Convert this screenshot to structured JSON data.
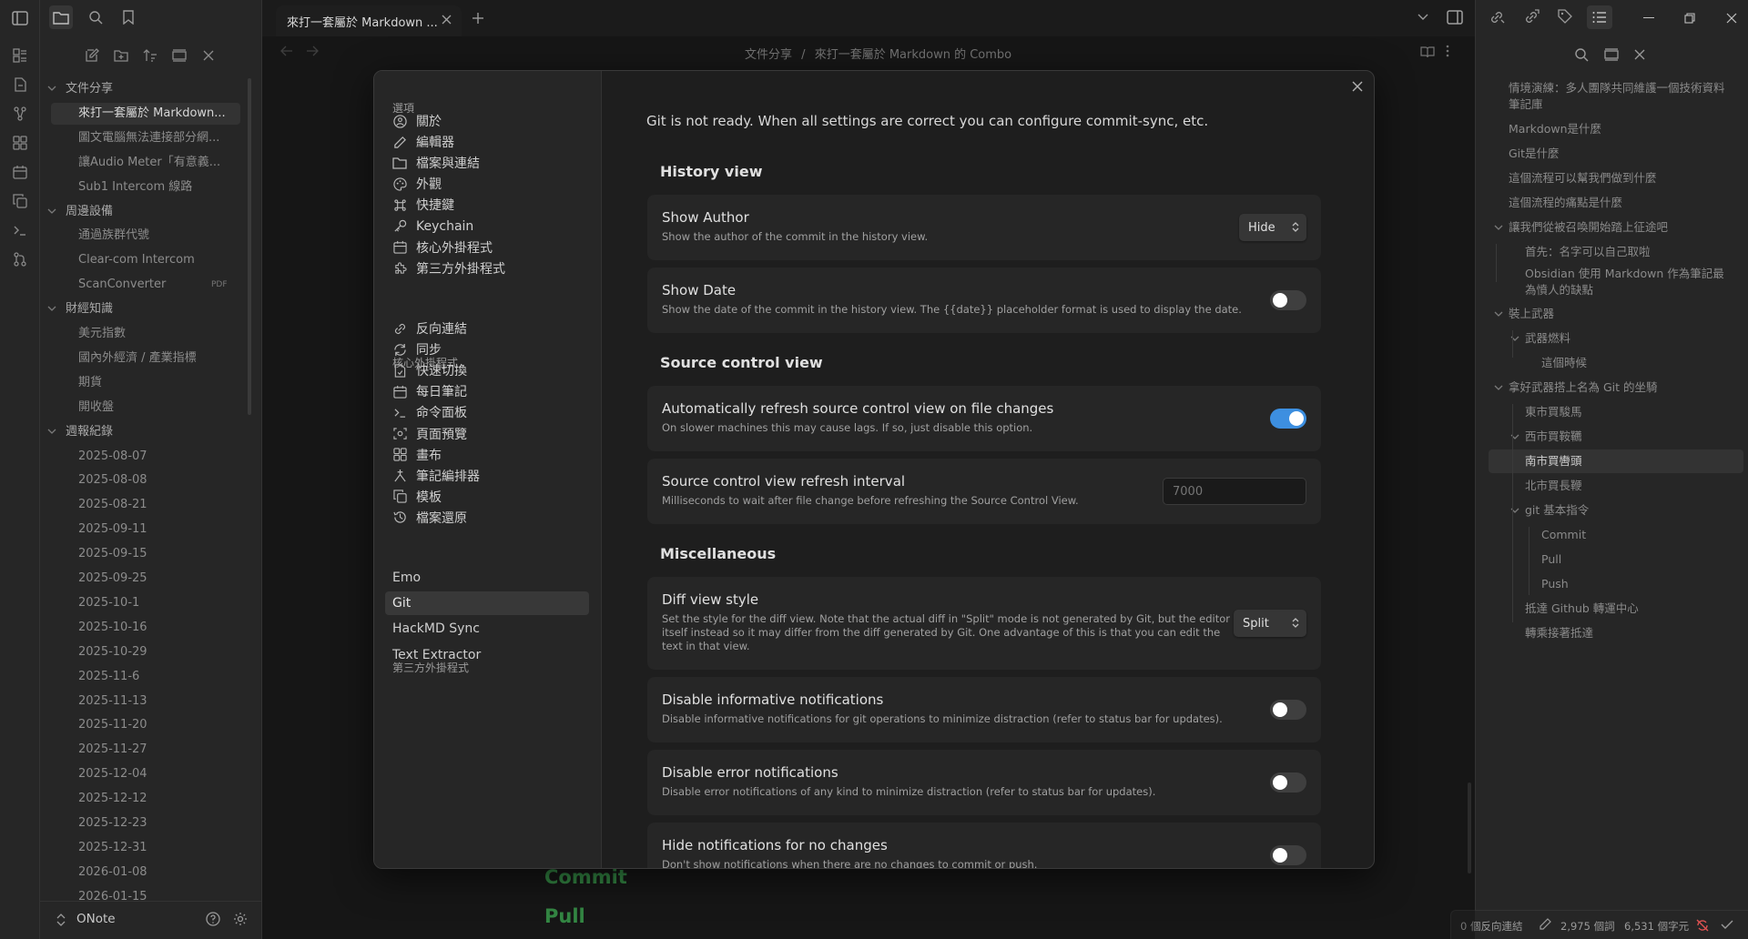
{
  "colors": {
    "accent": "#3d8fe0",
    "green_text": "#44b35a",
    "error_red": "#e05252"
  },
  "ribbon": {
    "icons": [
      "sidebar-toggle-icon",
      "dashboard-icon",
      "file-icon",
      "graph-icon",
      "canvas-icon",
      "calendar-icon",
      "copy-icon",
      "terminal-icon",
      "git-icon"
    ]
  },
  "explorer": {
    "vault_name": "ONote",
    "tree": [
      {
        "label": "文件分享",
        "type": "folder"
      },
      {
        "label": "來打一套屬於 Markdown...",
        "type": "file",
        "active": true
      },
      {
        "label": "圖文電腦無法連接部分網...",
        "type": "file"
      },
      {
        "label": "讓Audio Meter「有意義...",
        "type": "file"
      },
      {
        "label": "Sub1 Intercom 線路",
        "type": "file"
      },
      {
        "label": "周邊設備",
        "type": "folder"
      },
      {
        "label": "通過族群代號",
        "type": "file"
      },
      {
        "label": "Clear-com Intercom",
        "type": "file"
      },
      {
        "label": "ScanConverter",
        "type": "file",
        "badge": "PDF"
      },
      {
        "label": "財經知識",
        "type": "folder"
      },
      {
        "label": "美元指數",
        "type": "file"
      },
      {
        "label": "國內外經濟 / 產業指標",
        "type": "file"
      },
      {
        "label": "期貨",
        "type": "file"
      },
      {
        "label": "開收盤",
        "type": "file"
      },
      {
        "label": "週報紀錄",
        "type": "folder"
      },
      {
        "label": "2025-08-07",
        "type": "file"
      },
      {
        "label": "2025-08-08",
        "type": "file"
      },
      {
        "label": "2025-08-21",
        "type": "file"
      },
      {
        "label": "2025-09-11",
        "type": "file"
      },
      {
        "label": "2025-09-15",
        "type": "file"
      },
      {
        "label": "2025-09-25",
        "type": "file"
      },
      {
        "label": "2025-10-1",
        "type": "file"
      },
      {
        "label": "2025-10-16",
        "type": "file"
      },
      {
        "label": "2025-10-29",
        "type": "file"
      },
      {
        "label": "2025-11-6",
        "type": "file"
      },
      {
        "label": "2025-11-13",
        "type": "file"
      },
      {
        "label": "2025-11-20",
        "type": "file"
      },
      {
        "label": "2025-11-27",
        "type": "file"
      },
      {
        "label": "2025-12-04",
        "type": "file"
      },
      {
        "label": "2025-12-12",
        "type": "file"
      },
      {
        "label": "2025-12-23",
        "type": "file"
      },
      {
        "label": "2025-12-31",
        "type": "file"
      },
      {
        "label": "2026-01-08",
        "type": "file"
      },
      {
        "label": "2026-01-15",
        "type": "file"
      }
    ]
  },
  "tabs": [
    {
      "label": "來打一套屬於 Markdown ...",
      "active": true
    }
  ],
  "breadcrumb": {
    "folder": "文件分享",
    "separator": "/",
    "file": "來打一套屬於 Markdown 的 Combo"
  },
  "editor_background": {
    "line1": "Commit",
    "line2": "Pull"
  },
  "outline": [
    {
      "label": "情境演練：多人團隊共同維護一個技術資料筆記庫",
      "level": 1
    },
    {
      "label": "Markdown是什麼",
      "level": 1
    },
    {
      "label": "Git是什麼",
      "level": 1
    },
    {
      "label": "這個流程可以幫我們做到什麼",
      "level": 1
    },
    {
      "label": "這個流程的痛點是什麼",
      "level": 1
    },
    {
      "label": "讓我們從被召喚開始踏上征途吧",
      "level": 1,
      "collapsible": true
    },
    {
      "label": "首先：名字可以自己取啦",
      "level": 2
    },
    {
      "label": "Obsidian 使用 Markdown 作為筆記最為憤人的缺點",
      "level": 2
    },
    {
      "label": "裝上武器",
      "level": 1,
      "collapsible": true
    },
    {
      "label": "武器燃料",
      "level": 2,
      "collapsible": true
    },
    {
      "label": "這個時候",
      "level": 3
    },
    {
      "label": "拿好武器搭上名為 Git 的坐騎",
      "level": 1,
      "collapsible": true
    },
    {
      "label": "東市買駿馬",
      "level": 2
    },
    {
      "label": "西市買鞍韉",
      "level": 2,
      "collapsible": true
    },
    {
      "label": "南市買轡頭",
      "level": 2,
      "active": true
    },
    {
      "label": "北市買長鞭",
      "level": 2
    },
    {
      "label": "git 基本指令",
      "level": 2,
      "collapsible": true
    },
    {
      "label": "Commit",
      "level": 3
    },
    {
      "label": "Pull",
      "level": 3
    },
    {
      "label": "Push",
      "level": 3
    },
    {
      "label": "抵達 Github 轉運中心",
      "level": 2
    },
    {
      "label": "轉乘接著抵達",
      "level": 2
    }
  ],
  "status_bar": {
    "backlinks": "0 個反向連結",
    "words": "2,975 個詞",
    "chars": "6,531 個字元"
  },
  "settings": {
    "nav_options_heading": "選項",
    "nav_options": [
      {
        "label": "關於",
        "icon": "info-circle-icon"
      },
      {
        "label": "編輯器",
        "icon": "pencil-icon"
      },
      {
        "label": "檔案與連結",
        "icon": "folder-icon"
      },
      {
        "label": "外觀",
        "icon": "palette-icon"
      },
      {
        "label": "快捷鍵",
        "icon": "command-icon"
      },
      {
        "label": "Keychain",
        "icon": "key-icon"
      },
      {
        "label": "核心外掛程式",
        "icon": "plugin-icon"
      },
      {
        "label": "第三方外掛程式",
        "icon": "puzzle-icon"
      }
    ],
    "nav_core_heading": "核心外掛程式",
    "nav_core": [
      {
        "label": "反向連結",
        "icon": "backlink-icon"
      },
      {
        "label": "同步",
        "icon": "sync-icon"
      },
      {
        "label": "快速切換",
        "icon": "quick-switch-icon"
      },
      {
        "label": "每日筆記",
        "icon": "calendar-icon"
      },
      {
        "label": "命令面板",
        "icon": "terminal-icon"
      },
      {
        "label": "頁面預覽",
        "icon": "preview-icon"
      },
      {
        "label": "畫布",
        "icon": "canvas-icon"
      },
      {
        "label": "筆記編排器",
        "icon": "composer-icon"
      },
      {
        "label": "模板",
        "icon": "template-icon"
      },
      {
        "label": "檔案還原",
        "icon": "history-icon"
      }
    ],
    "nav_community_heading": "第三方外掛程式",
    "nav_community": [
      {
        "label": "Emo"
      },
      {
        "label": "Git",
        "active": true
      },
      {
        "label": "HackMD Sync"
      },
      {
        "label": "Text Extractor"
      }
    ],
    "notice": "Git is not ready. When all settings are correct you can configure commit-sync, etc.",
    "sections": {
      "history": "History view",
      "source_control": "Source control view",
      "misc": "Miscellaneous"
    },
    "show_author": {
      "name": "Show Author",
      "desc": "Show the author of the commit in the history view.",
      "value": "Hide"
    },
    "show_date": {
      "name": "Show Date",
      "desc": "Show the date of the commit in the history view. The {{date}} placeholder format is used to display the date.",
      "enabled": false
    },
    "auto_refresh": {
      "name": "Automatically refresh source control view on file changes",
      "desc": "On slower machines this may cause lags. If so, just disable this option.",
      "enabled": true
    },
    "refresh_interval": {
      "name": "Source control view refresh interval",
      "desc": "Milliseconds to wait after file change before refreshing the Source Control View.",
      "placeholder": "7000"
    },
    "diff_style": {
      "name": "Diff view style",
      "desc": "Set the style for the diff view. Note that the actual diff in \"Split\" mode is not generated by Git, but the editor itself instead so it may differ from the diff generated by Git. One advantage of this is that you can edit the text in that view.",
      "value": "Split"
    },
    "disable_info": {
      "name": "Disable informative notifications",
      "desc": "Disable informative notifications for git operations to minimize distraction (refer to status bar for updates).",
      "enabled": false
    },
    "disable_error": {
      "name": "Disable error notifications",
      "desc": "Disable error notifications of any kind to minimize distraction (refer to status bar for updates).",
      "enabled": false
    },
    "hide_no_changes": {
      "name": "Hide notifications for no changes",
      "desc": "Don't show notifications when there are no changes to commit or push.",
      "enabled": false
    }
  }
}
